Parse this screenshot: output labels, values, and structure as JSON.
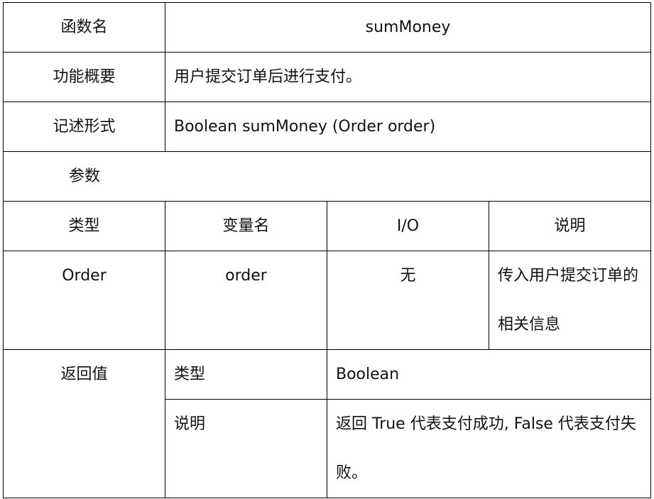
{
  "function_name": {
    "label": "函数名",
    "value": "sumMoney"
  },
  "overview": {
    "label": "功能概要",
    "value": "用户提交订单后进行支付。"
  },
  "signature": {
    "label": "记述形式",
    "value": "Boolean sumMoney (Order order)"
  },
  "params": {
    "section_label": "参数",
    "headers": {
      "type": "类型",
      "name": "变量名",
      "io": "I/O",
      "desc": "说明"
    },
    "rows": [
      {
        "type": "Order",
        "name": "order",
        "io": "无",
        "desc": "传入用户提交订单的相关信息"
      }
    ]
  },
  "return": {
    "label": "返回值",
    "type_label": "类型",
    "type_value": "Boolean",
    "desc_label": "说明",
    "desc_value": "返回 True 代表支付成功, False 代表支付失败。"
  }
}
